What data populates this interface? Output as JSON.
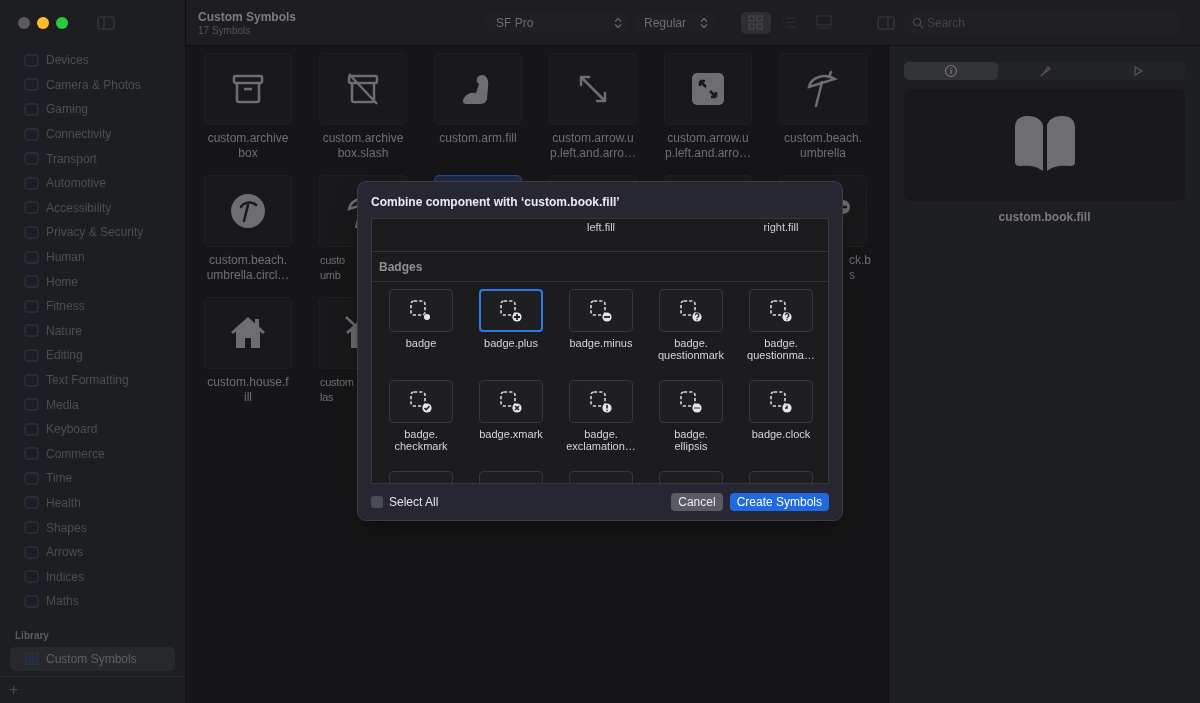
{
  "window": {
    "title": "Custom Symbols",
    "subtitle": "17 Symbols"
  },
  "toolbar": {
    "font_popup": "SF Pro",
    "weight_popup": "Regular",
    "views": [
      {
        "selected": true
      },
      {
        "selected": false
      },
      {
        "selected": false
      }
    ],
    "search": {
      "placeholder": "Search"
    }
  },
  "sidebar": {
    "items": [
      {
        "label": "Devices",
        "selected": false
      },
      {
        "label": "Camera & Photos",
        "selected": false
      },
      {
        "label": "Gaming",
        "selected": false
      },
      {
        "label": "Connectivity",
        "selected": false
      },
      {
        "label": "Transport",
        "selected": false
      },
      {
        "label": "Automotive",
        "selected": false
      },
      {
        "label": "Accessibility",
        "selected": false
      },
      {
        "label": "Privacy & Security",
        "selected": false
      },
      {
        "label": "Human",
        "selected": false
      },
      {
        "label": "Home",
        "selected": false
      },
      {
        "label": "Fitness",
        "selected": false
      },
      {
        "label": "Nature",
        "selected": false
      },
      {
        "label": "Editing",
        "selected": false
      },
      {
        "label": "Text Formatting",
        "selected": false
      },
      {
        "label": "Media",
        "selected": false
      },
      {
        "label": "Keyboard",
        "selected": false
      },
      {
        "label": "Commerce",
        "selected": false
      },
      {
        "label": "Time",
        "selected": false
      },
      {
        "label": "Health",
        "selected": false
      },
      {
        "label": "Shapes",
        "selected": false
      },
      {
        "label": "Arrows",
        "selected": false
      },
      {
        "label": "Indices",
        "selected": false
      },
      {
        "label": "Maths",
        "selected": false
      }
    ],
    "library_header": "Library",
    "library_items": [
      {
        "label": "Custom Symbols",
        "selected": true
      }
    ],
    "add_button": "+"
  },
  "grid": {
    "rows": [
      [
        {
          "lines": [
            "custom.archive",
            "box"
          ],
          "selected": false
        },
        {
          "lines": [
            "custom.archive",
            "box.slash"
          ],
          "selected": false
        },
        {
          "lines": [
            "custom.arm.fill"
          ],
          "selected": false
        },
        {
          "lines": [
            "custom.arrow.u",
            "p.left.and.arro…"
          ],
          "selected": false
        },
        {
          "lines": [
            "custom.arrow.u",
            "p.left.and.arro…"
          ],
          "selected": false
        },
        {
          "lines": [
            "custom.beach.",
            "umbrella"
          ],
          "selected": false
        }
      ],
      [
        {
          "lines": [
            "custom.beach.",
            "umbrella.circl…"
          ],
          "selected": false
        },
        {
          "lines": [
            "custo",
            "umb"
          ],
          "selected": false,
          "kind": "cut-end"
        },
        {
          "selected": true
        },
        {
          "selected": false
        },
        {
          "selected": false
        },
        {
          "lines": [
            "ck.b",
            "s"
          ],
          "selected": false,
          "kind": "cut-start"
        }
      ],
      [
        {
          "lines": [
            "custom.house.f",
            "ill"
          ],
          "selected": false
        },
        {
          "lines": [
            "custom",
            "las"
          ],
          "selected": false,
          "kind": "cut-end"
        }
      ]
    ]
  },
  "inspector": {
    "tabs": [
      {
        "selected": true
      },
      {
        "selected": false
      },
      {
        "selected": false
      }
    ],
    "name": "custom.book.fill"
  },
  "dialog": {
    "title": "Combine component with ‘custom.book.fill’",
    "previous_labels": [
      "left.fill",
      "right.fill"
    ],
    "section": "Badges",
    "items": [
      {
        "lines": [
          "badge"
        ],
        "selected": false
      },
      {
        "lines": [
          "badge.plus"
        ],
        "selected": true
      },
      {
        "lines": [
          "badge.minus"
        ],
        "selected": false
      },
      {
        "lines": [
          "badge.",
          "questionmark"
        ],
        "selected": false
      },
      {
        "lines": [
          "badge.",
          "questionma…"
        ],
        "selected": false
      },
      {
        "lines": [
          "badge.",
          "checkmark"
        ],
        "selected": false
      },
      {
        "lines": [
          "badge.xmark"
        ],
        "selected": false
      },
      {
        "lines": [
          "badge.",
          "exclamation…"
        ],
        "selected": false
      },
      {
        "lines": [
          "badge.",
          "ellipsis"
        ],
        "selected": false
      },
      {
        "lines": [
          "badge.clock"
        ],
        "selected": false
      },
      {
        "selected": false
      },
      {
        "selected": false
      },
      {
        "selected": false
      },
      {
        "selected": false
      },
      {
        "selected": false
      }
    ],
    "select_all": {
      "label": "Select All",
      "checked": false
    },
    "buttons": [
      {
        "label": "Cancel",
        "kind": "secondary"
      },
      {
        "label": "Create Symbols",
        "kind": "primary"
      }
    ]
  }
}
